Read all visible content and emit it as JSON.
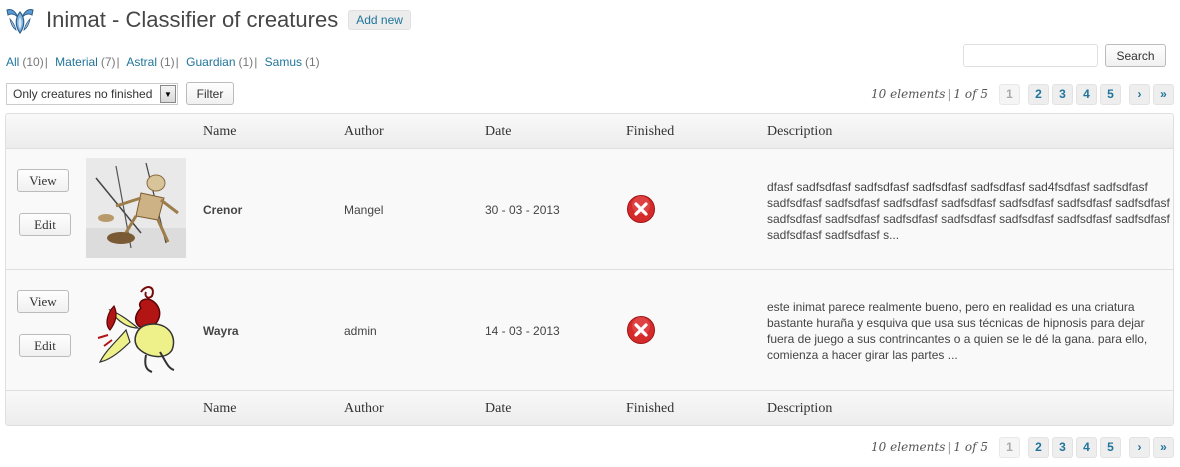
{
  "header": {
    "title": "Inimat - Classifier of creatures",
    "add_new": "Add new"
  },
  "filters": [
    {
      "label": "All",
      "count": "(10)",
      "sep": "|"
    },
    {
      "label": "Material",
      "count": "(7)",
      "sep": "|"
    },
    {
      "label": "Astral",
      "count": "(1)",
      "sep": "|"
    },
    {
      "label": "Guardian",
      "count": "(1)",
      "sep": "|"
    },
    {
      "label": "Samus",
      "count": "(1)",
      "sep": ""
    }
  ],
  "search": {
    "value": "",
    "button": "Search"
  },
  "filter_select": {
    "selected": "Only creatures no finished",
    "button": "Filter"
  },
  "pagination": {
    "count_text": "10 elements",
    "separator": "|",
    "page_text": "1 of 5",
    "pages": [
      "1",
      "2",
      "3",
      "4",
      "5"
    ],
    "current": "1",
    "next": "›",
    "last": "»"
  },
  "columns": [
    "Name",
    "Author",
    "Date",
    "Finished",
    "Description"
  ],
  "rows": [
    {
      "view": "View",
      "edit": "Edit",
      "name": "Crenor",
      "author": "Mangel",
      "date": "30 - 03 - 2013",
      "finished_icon": "red-x-circle-icon",
      "description": "dfasf sadfsdfasf sadfsdfasf sadfsdfasf sadfsdfasf sad4fsdfasf sadfsdfasf sadfsdfasf sadfsdfasf sadfsdfasf sadfsdfasf sadfsdfasf sadfsdfasf sadfsdfasf sadfsdfasf sadfsdfasf sadfsdfasf sadfsdfasf sadfsdfasf sadfsdfasf sadfsdfasf sadfsdfasf sadfsdfasf s..."
    },
    {
      "view": "View",
      "edit": "Edit",
      "name": "Wayra",
      "author": "admin",
      "date": "14 - 03 - 2013",
      "finished_icon": "red-x-circle-icon",
      "description": "este inimat parece realmente bueno, pero en realidad es una criatura bastante huraña y esquiva que usa sus técnicas de hipnosis para dejar fuera de juego a sus contrincantes o a quien se le dé la gana. para ello, comienza a hacer girar las partes ..."
    }
  ],
  "colors": {
    "link": "#21759b",
    "status_red": "#d52a2a"
  }
}
